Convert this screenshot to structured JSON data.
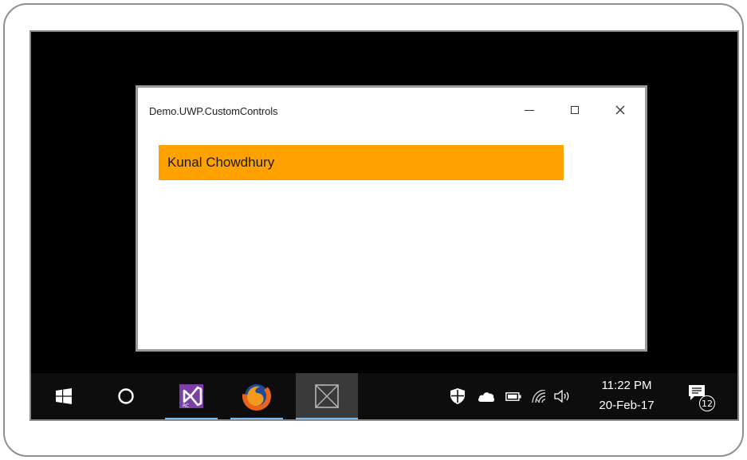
{
  "window": {
    "title": "Demo.UWP.CustomControls",
    "controls": {
      "minimize": "minimize-icon",
      "maximize": "maximize-icon",
      "close": "close-icon"
    }
  },
  "content": {
    "name_label": "Kunal Chowdhury",
    "name_bar_color": "#ffa200"
  },
  "taskbar": {
    "items": [
      {
        "icon": "windows-start-icon"
      },
      {
        "icon": "cortana-search-icon"
      },
      {
        "icon": "visual-studio-rc-icon",
        "active": true
      },
      {
        "icon": "firefox-icon",
        "active": true
      },
      {
        "icon": "uwp-app-icon",
        "active": true,
        "focused": true
      }
    ],
    "tray": [
      "defender-shield-icon",
      "onedrive-cloud-icon",
      "battery-icon",
      "wifi-icon",
      "volume-icon"
    ],
    "clock": {
      "time": "11:22 PM",
      "date": "20-Feb-17"
    },
    "notifications": {
      "count": "12"
    },
    "accent_color": "#76b9ed"
  }
}
